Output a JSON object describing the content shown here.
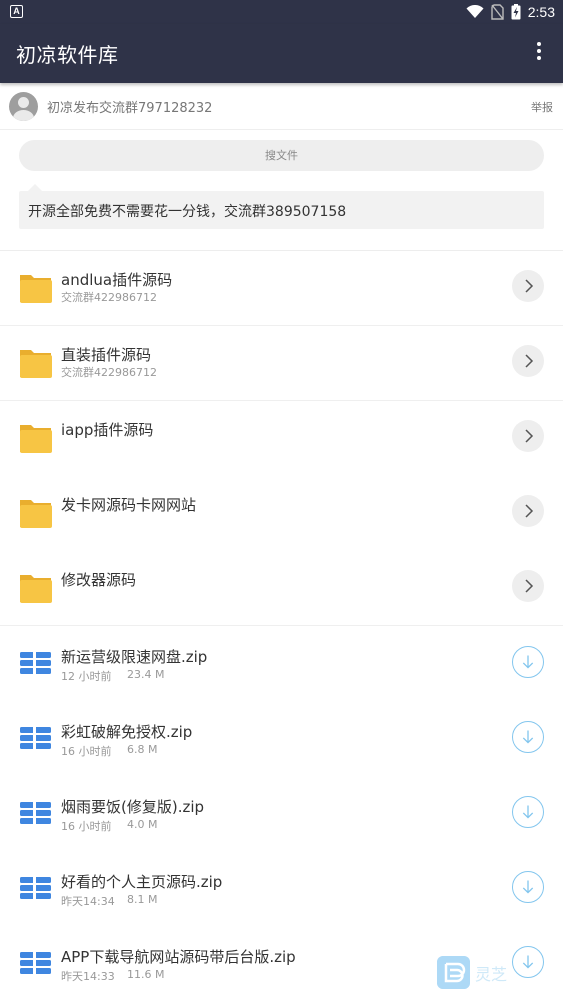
{
  "status_bar": {
    "app_badge": "A",
    "time": "2:53",
    "icons": [
      "wifi-icon",
      "no-sim-icon",
      "battery-charging-icon"
    ]
  },
  "app_bar": {
    "title": "初凉软件库",
    "menu_icon": "more-vert-icon"
  },
  "author": {
    "text": "初凉发布交流群797128232",
    "report": "举报",
    "avatar_icon": "default-avatar-icon"
  },
  "search": {
    "placeholder": "搜文件"
  },
  "notice": {
    "text": "开源全部免费不需要花一分钱，交流群389507158"
  },
  "folders": [
    {
      "name": "andlua插件源码",
      "desc": "交流群422986712"
    },
    {
      "name": "直装插件源码",
      "desc": "交流群422986712"
    },
    {
      "name": "iapp插件源码",
      "desc": ""
    },
    {
      "name": "发卡网源码卡网网站",
      "desc": ""
    },
    {
      "name": "修改器源码",
      "desc": ""
    }
  ],
  "files": [
    {
      "name": "新运营级限速网盘.zip",
      "time": "12 小时前",
      "size": "23.4 M"
    },
    {
      "name": "彩虹破解免授权.zip",
      "time": "16 小时前",
      "size": "6.8 M"
    },
    {
      "name": "烟雨要饭(修复版).zip",
      "time": "16 小时前",
      "size": "4.0 M"
    },
    {
      "name": "好看的个人主页源码.zip",
      "time": "昨天14:34",
      "size": "8.1 M"
    },
    {
      "name": "APP下载导航网站源码带后台版.zip",
      "time": "昨天14:33",
      "size": "11.6 M"
    }
  ],
  "colors": {
    "app_bar": "#2f3348",
    "folder": "#f7c544",
    "archive": "#3f86e0",
    "download_ring": "#83c6ee"
  },
  "watermark": {
    "text": "灵芝"
  }
}
